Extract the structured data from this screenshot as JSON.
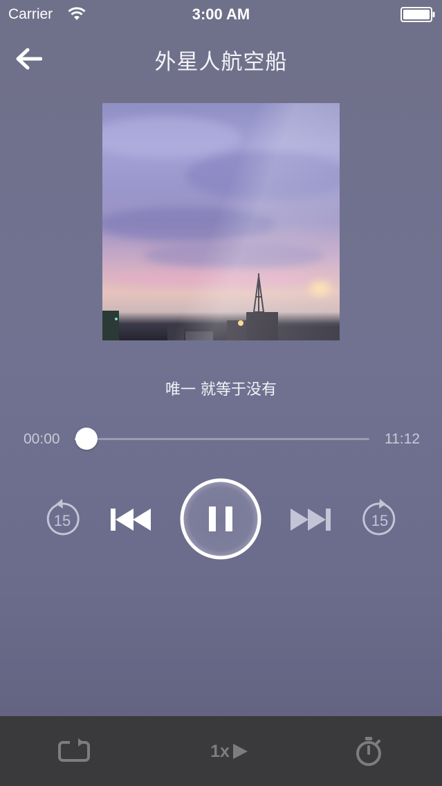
{
  "status_bar": {
    "carrier": "Carrier",
    "time": "3:00 AM"
  },
  "nav": {
    "title": "外星人航空船",
    "back_icon": "arrow-left-icon"
  },
  "track": {
    "subtitle": "唯一 就等于没有"
  },
  "progress": {
    "elapsed": "00:00",
    "total": "11:12",
    "fraction": 0.04
  },
  "controls": {
    "rewind_seconds": "15",
    "forward_seconds": "15",
    "rewind_icon": "rewind-15-icon",
    "previous_icon": "skip-previous-icon",
    "play_state_icon": "pause-icon",
    "next_icon": "skip-next-icon",
    "forward_icon": "forward-15-icon"
  },
  "toolbar": {
    "repeat_icon": "repeat-icon",
    "speed_label": "1x",
    "speed_icon": "play-triangle-icon",
    "timer_icon": "timer-icon"
  },
  "colors": {
    "background": "#6f7089",
    "toolbar": "#3a3a3c",
    "toolbar_icon": "#7d7d81",
    "control_dim": "#c4c4d6"
  }
}
